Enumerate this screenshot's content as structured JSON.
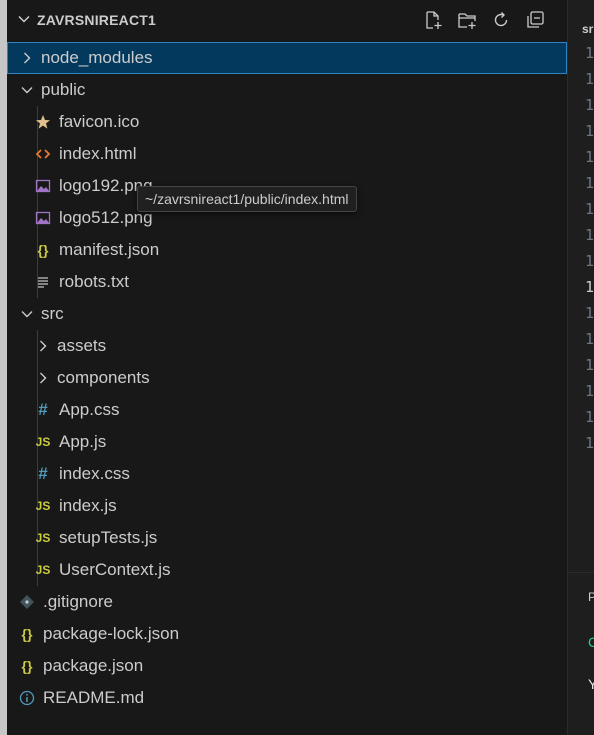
{
  "explorer": {
    "title": "ZAVRSNIREACT1",
    "tree": [
      {
        "label": "node_modules",
        "kind": "folder",
        "expanded": false,
        "selected": true
      },
      {
        "label": "public",
        "kind": "folder",
        "expanded": true
      },
      {
        "label": "favicon.ico",
        "kind": "star",
        "color": "#e2c08d"
      },
      {
        "label": "index.html",
        "kind": "html",
        "color": "#e37933"
      },
      {
        "label": "logo192.png",
        "kind": "image",
        "color": "#a074c4"
      },
      {
        "label": "logo512.png",
        "kind": "image",
        "color": "#a074c4"
      },
      {
        "label": "manifest.json",
        "kind": "json",
        "color": "#cbcb41"
      },
      {
        "label": "robots.txt",
        "kind": "text",
        "color": "#c5c5c5"
      },
      {
        "label": "src",
        "kind": "folder",
        "expanded": true
      },
      {
        "label": "assets",
        "kind": "folder",
        "expanded": false
      },
      {
        "label": "components",
        "kind": "folder",
        "expanded": false
      },
      {
        "label": "App.css",
        "kind": "css",
        "color": "#519aba"
      },
      {
        "label": "App.js",
        "kind": "js",
        "color": "#cbcb41"
      },
      {
        "label": "index.css",
        "kind": "css",
        "color": "#519aba"
      },
      {
        "label": "index.js",
        "kind": "js",
        "color": "#cbcb41"
      },
      {
        "label": "setupTests.js",
        "kind": "js",
        "color": "#cbcb41"
      },
      {
        "label": "UserContext.js",
        "kind": "js",
        "color": "#cbcb41"
      },
      {
        "label": ".gitignore",
        "kind": "git",
        "color": "#41535b"
      },
      {
        "label": "package-lock.json",
        "kind": "json",
        "color": "#cbcb41"
      },
      {
        "label": "package.json",
        "kind": "json",
        "color": "#cbcb41"
      },
      {
        "label": "README.md",
        "kind": "info",
        "color": "#519aba"
      }
    ],
    "tooltip": "~/zavrsnireact1/public/index.html"
  },
  "editor": {
    "tab_fragment": "sr",
    "line_digits": [
      "1",
      "1",
      "1",
      "1",
      "1",
      "1",
      "1",
      "1",
      "1",
      "1",
      "1",
      "1",
      "1",
      "1",
      "1",
      "1"
    ],
    "panel_letters": [
      "P",
      "C",
      "Y"
    ]
  },
  "colors": {
    "selected_bg": "#04395e",
    "selected_border": "#2d83c6",
    "text": "#cccccc"
  }
}
